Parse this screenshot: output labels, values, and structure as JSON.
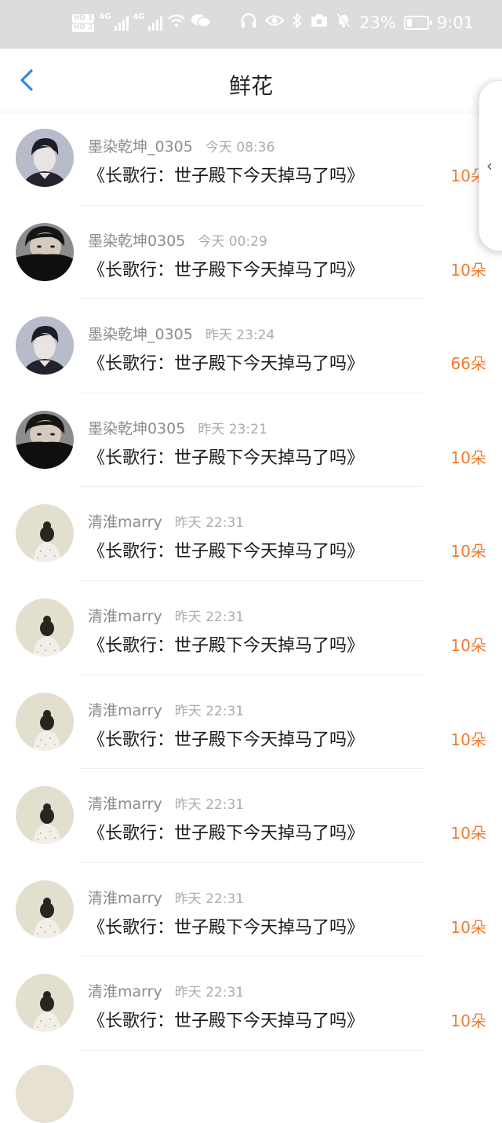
{
  "status_bar": {
    "hd1": "HD 1",
    "hd2": "HD 2",
    "sig1": "4G",
    "sig2": "4G",
    "battery_percent": "23%",
    "time": "9:01",
    "icons": [
      "wifi-icon",
      "wechat-icon",
      "headphones-icon",
      "eye-icon",
      "bluetooth-icon",
      "camera-icon",
      "mute-bell-icon",
      "battery-icon"
    ]
  },
  "nav": {
    "title": "鲜花",
    "back_icon": "chevron-left-icon"
  },
  "side_tab": {
    "glyph": "‹"
  },
  "colors": {
    "accent": "#f07a2e",
    "back_arrow": "#2e8ae6"
  },
  "records": [
    {
      "user": "墨染乾坤_0305",
      "time": "今天 08:36",
      "title": "《长歌行：世子殿下今天掉马了吗》",
      "count": "10朵",
      "avatar": "boy-portrait"
    },
    {
      "user": "墨染乾坤0305",
      "time": "今天 00:29",
      "title": "《长歌行：世子殿下今天掉马了吗》",
      "count": "10朵",
      "avatar": "masked-man"
    },
    {
      "user": "墨染乾坤_0305",
      "time": "昨天 23:24",
      "title": "《长歌行：世子殿下今天掉马了吗》",
      "count": "66朵",
      "avatar": "boy-portrait"
    },
    {
      "user": "墨染乾坤0305",
      "time": "昨天 23:21",
      "title": "《长歌行：世子殿下今天掉马了吗》",
      "count": "10朵",
      "avatar": "masked-man"
    },
    {
      "user": "清淮marry",
      "time": "昨天 22:31",
      "title": "《长歌行：世子殿下今天掉马了吗》",
      "count": "10朵",
      "avatar": "girl-back"
    },
    {
      "user": "清淮marry",
      "time": "昨天 22:31",
      "title": "《长歌行：世子殿下今天掉马了吗》",
      "count": "10朵",
      "avatar": "girl-back"
    },
    {
      "user": "清淮marry",
      "time": "昨天 22:31",
      "title": "《长歌行：世子殿下今天掉马了吗》",
      "count": "10朵",
      "avatar": "girl-back"
    },
    {
      "user": "清淮marry",
      "time": "昨天 22:31",
      "title": "《长歌行：世子殿下今天掉马了吗》",
      "count": "10朵",
      "avatar": "girl-back"
    },
    {
      "user": "清淮marry",
      "time": "昨天 22:31",
      "title": "《长歌行：世子殿下今天掉马了吗》",
      "count": "10朵",
      "avatar": "girl-back"
    },
    {
      "user": "清淮marry",
      "time": "昨天 22:31",
      "title": "《长歌行：世子殿下今天掉马了吗》",
      "count": "10朵",
      "avatar": "girl-back"
    }
  ]
}
